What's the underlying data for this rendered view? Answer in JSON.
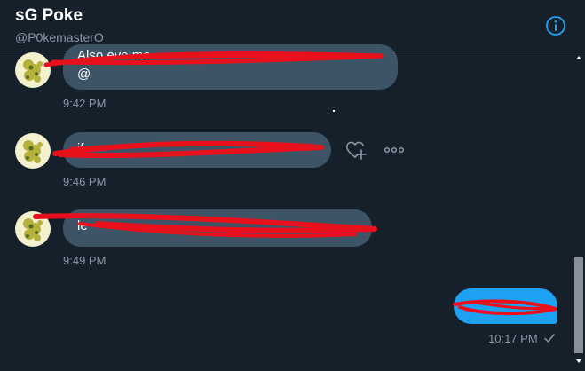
{
  "header": {
    "name": "sG Poke",
    "handle": "@P0kemasterO",
    "info_icon": "info-circle-icon"
  },
  "messages": [
    {
      "sender": "other",
      "text_visible": "Also eve  me",
      "text_line2": "@",
      "timestamp": "9:42 PM",
      "obscured": true
    },
    {
      "sender": "other",
      "text_visible": "if",
      "timestamp": "9:46 PM",
      "obscured": true
    },
    {
      "sender": "other",
      "text_visible": "le",
      "timestamp": "9:49 PM",
      "obscured": true
    },
    {
      "sender": "self",
      "text_visible": "",
      "timestamp": "10:17 PM",
      "obscured": true
    }
  ],
  "actions": {
    "react_icon": "heart-plus-icon",
    "more_icon": "more-horizontal-icon"
  },
  "sent_receipt_icon": "checkmark-icon",
  "colors": {
    "background": "#15202b",
    "incoming_bubble": "#3d5466",
    "outgoing_bubble": "#1da1f2",
    "accent": "#1da1f2",
    "muted_text": "#8899a6",
    "redaction": "#e8111b"
  }
}
